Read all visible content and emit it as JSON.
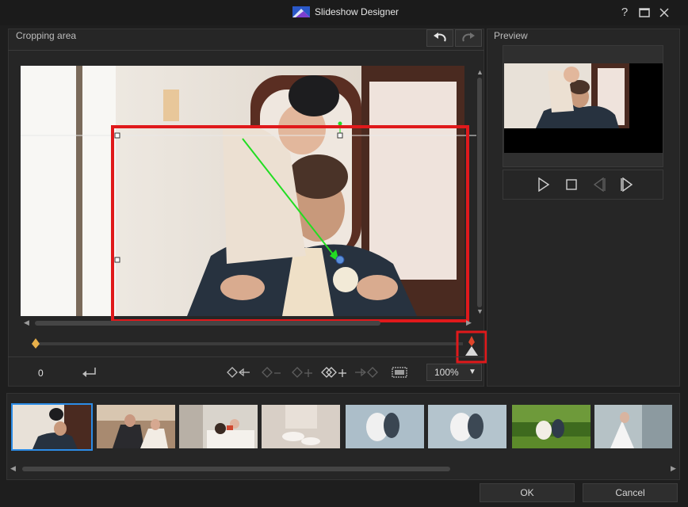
{
  "window": {
    "title": "Slideshow Designer",
    "help_label": "?",
    "maximize_label": "☐",
    "close_label": "✕"
  },
  "crop": {
    "title": "Cropping area",
    "position_value": "0",
    "zoom_value": "100%"
  },
  "preview": {
    "title": "Preview"
  },
  "dialog": {
    "ok_label": "OK",
    "cancel_label": "Cancel"
  },
  "colors": {
    "highlight_red": "#e0191b",
    "motion_green": "#22dd22",
    "selected_thumb_border": "#2c8ce6"
  }
}
